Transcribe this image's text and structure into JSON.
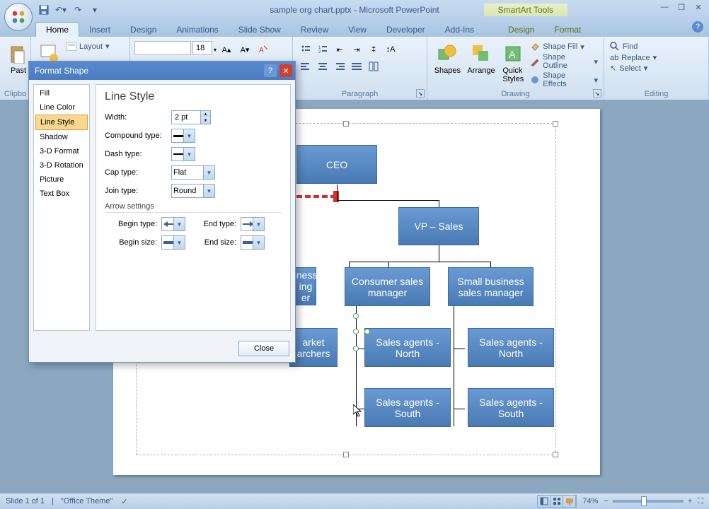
{
  "app": {
    "title": "sample org chart.pptx - Microsoft PowerPoint",
    "contextual_title": "SmartArt Tools"
  },
  "qat": [
    "save",
    "undo",
    "redo"
  ],
  "tabs": {
    "home": "Home",
    "insert": "Insert",
    "design": "Design",
    "animations": "Animations",
    "slideshow": "Slide Show",
    "review": "Review",
    "view": "View",
    "developer": "Developer",
    "addins": "Add-Ins",
    "sa_design": "Design",
    "sa_format": "Format"
  },
  "ribbon": {
    "clipboard": {
      "label": "Clipbo",
      "paste": "Past"
    },
    "slides": {
      "layout": "Layout"
    },
    "font": {
      "size": "18"
    },
    "paragraph": {
      "label": "Paragraph"
    },
    "drawing": {
      "label": "Drawing",
      "shapes": "Shapes",
      "arrange": "Arrange",
      "quick": "Quick\nStyles",
      "shape_fill": "Shape Fill",
      "shape_outline": "Shape Outline",
      "shape_effects": "Shape Effects"
    },
    "editing": {
      "label": "Editing",
      "find": "Find",
      "replace": "Replace",
      "select": "Select"
    }
  },
  "dialog": {
    "title": "Format Shape",
    "nav": {
      "fill": "Fill",
      "line_color": "Line Color",
      "line_style": "Line Style",
      "shadow": "Shadow",
      "format3d": "3-D Format",
      "rotation3d": "3-D Rotation",
      "picture": "Picture",
      "textbox": "Text Box"
    },
    "panel": {
      "title": "Line Style",
      "width_label": "Width:",
      "width_value": "2 pt",
      "compound_label": "Compound type:",
      "dash_label": "Dash type:",
      "cap_label": "Cap type:",
      "cap_value": "Flat",
      "join_label": "Join type:",
      "join_value": "Round",
      "arrow_section": "Arrow settings",
      "begin_type": "Begin type:",
      "end_type": "End type:",
      "begin_size": "Begin size:",
      "end_size": "End size:"
    },
    "close": "Close"
  },
  "chart_data": {
    "type": "org_chart",
    "nodes": [
      {
        "id": "ceo",
        "label": "CEO"
      },
      {
        "id": "vp_sales",
        "label": "VP – Sales",
        "parent": "ceo"
      },
      {
        "id": "biz_mgr",
        "label": "iness\ning\ner",
        "parent": "vp_sales",
        "note": "partially hidden: Business something manager"
      },
      {
        "id": "consumer_mgr",
        "label": "Consumer sales manager",
        "parent": "vp_sales"
      },
      {
        "id": "small_biz_mgr",
        "label": "Small business sales manager",
        "parent": "vp_sales"
      },
      {
        "id": "mkt_res",
        "label": "arket\narchers",
        "parent": "biz_mgr",
        "note": "partially hidden: Market researchers"
      },
      {
        "id": "agents_n_1",
        "label": "Sales agents - North",
        "parent": "consumer_mgr"
      },
      {
        "id": "agents_s_1",
        "label": "Sales agents - South",
        "parent": "consumer_mgr"
      },
      {
        "id": "agents_n_2",
        "label": "Sales agents - North",
        "parent": "small_biz_mgr"
      },
      {
        "id": "agents_s_2",
        "label": "Sales agents - South",
        "parent": "small_biz_mgr"
      }
    ]
  },
  "org": {
    "ceo": "CEO",
    "vp_sales": "VP – Sales",
    "biz_mgr": "iness\ning\ner",
    "consumer_mgr": "Consumer sales manager",
    "small_biz_mgr": "Small business sales manager",
    "mkt_res": "arket\narchers",
    "agents_n_1": "Sales agents - North",
    "agents_s_1": "Sales agents - South",
    "agents_n_2": "Sales agents - North",
    "agents_s_2": "Sales agents - South"
  },
  "status": {
    "slide": "Slide 1 of 1",
    "theme": "\"Office Theme\"",
    "zoom": "74%"
  }
}
